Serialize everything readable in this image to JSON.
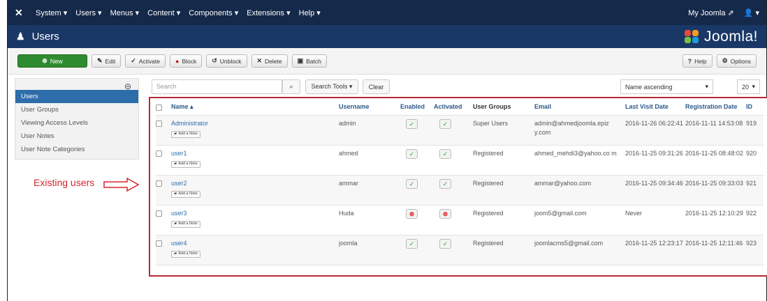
{
  "topnav": {
    "menus": [
      "System ▾",
      "Users ▾",
      "Menus ▾",
      "Content ▾",
      "Components ▾",
      "Extensions ▾",
      "Help ▾"
    ],
    "site_link": "My Joomla ⇗",
    "user_menu": "👤 ▾"
  },
  "header": {
    "title": "Users",
    "brand": "Joomla!"
  },
  "toolbar": {
    "buttons": [
      "New",
      "Edit",
      "Activate",
      "Block",
      "Unblock",
      "Delete",
      "Batch"
    ],
    "help": "Help",
    "options": "Options"
  },
  "sidebar": {
    "items": [
      "Users",
      "User Groups",
      "Viewing Access Levels",
      "User Notes",
      "User Note Categories"
    ]
  },
  "filter": {
    "search_placeholder": "Search",
    "search_tools": "Search Tools ▾",
    "clear": "Clear",
    "sort": "Name ascending",
    "limit": "20"
  },
  "table": {
    "headers": [
      "Name ▴",
      "Username",
      "Enabled",
      "Activated",
      "User Groups",
      "Email",
      "Last Visit Date",
      "Registration Date",
      "ID"
    ],
    "rows": [
      {
        "name": "Administrator",
        "note": "Add a Note",
        "username": "admin",
        "enabled": "ok",
        "activated": "ok",
        "group": "Super Users",
        "email": "admin@ahmedjoomla.epiz y.com",
        "last": "2016-11-26 06:22:41",
        "reg": "2016-11-11 14:53:08",
        "id": "919"
      },
      {
        "name": "user1",
        "note": "Add a Note",
        "username": "ahmed",
        "enabled": "ok",
        "activated": "ok",
        "group": "Registered",
        "email": "ahmed_mehdi3@yahoo.co m",
        "last": "2016-11-25 09:31:26",
        "reg": "2016-11-25 08:48:02",
        "id": "920"
      },
      {
        "name": "user2",
        "note": "Add a Note",
        "username": "ammar",
        "enabled": "ok",
        "activated": "ok",
        "group": "Registered",
        "email": "ammar@yahoo.com",
        "last": "2016-11-25 09:34:46",
        "reg": "2016-11-25 09:33:03",
        "id": "921"
      },
      {
        "name": "user3",
        "note": "Add a Note",
        "username": "Huda",
        "enabled": "bad",
        "activated": "bad",
        "group": "Registered",
        "email": "joom5@gmail.com",
        "last": "Never",
        "reg": "2016-11-25 12:10:29",
        "id": "922"
      },
      {
        "name": "user4",
        "note": "Add a Note",
        "username": "joomla",
        "enabled": "ok",
        "activated": "ok",
        "group": "Registered",
        "email": "joomlacms5@gmail.com",
        "last": "2016-11-25 12:23:17",
        "reg": "2016-11-25 12:11:46",
        "id": "923"
      }
    ]
  },
  "annotation": "Existing users"
}
